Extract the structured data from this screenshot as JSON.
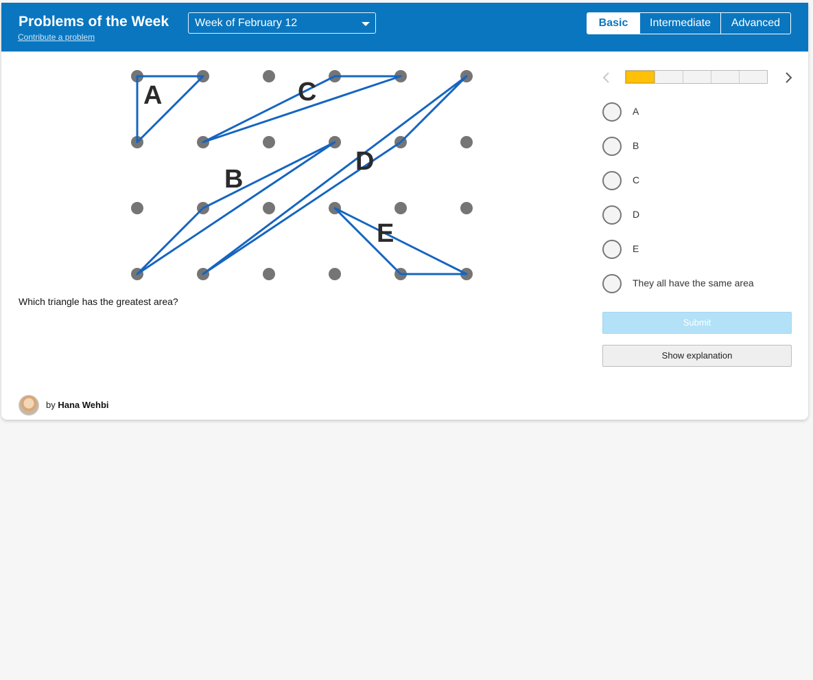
{
  "header": {
    "title": "Problems of the Week",
    "contribute_link": "Contribute a problem",
    "week_select": "Week of February 12",
    "levels": [
      "Basic",
      "Intermediate",
      "Advanced"
    ],
    "active_level": "Basic"
  },
  "figure": {
    "triangle_labels": [
      "A",
      "B",
      "C",
      "D",
      "E"
    ],
    "line_color": "#1565c0",
    "dot_color": "#757575"
  },
  "question": "Which triangle has the greatest area?",
  "progress": {
    "current": 1,
    "total": 5,
    "current_color": "#ffc107"
  },
  "options": [
    "A",
    "B",
    "C",
    "D",
    "E",
    "They all have the same area"
  ],
  "buttons": {
    "submit": "Submit",
    "explanation": "Show explanation"
  },
  "author": {
    "prefix": "by",
    "name": "Hana Wehbi"
  }
}
